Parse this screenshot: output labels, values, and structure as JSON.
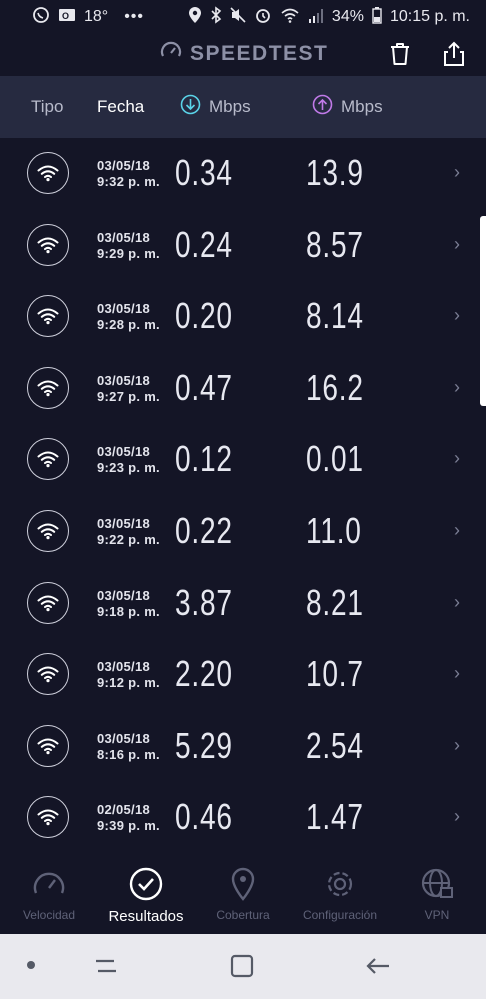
{
  "status_bar": {
    "temperature": "18°",
    "overflow": "•••",
    "battery": "34%",
    "time": "10:15 p. m."
  },
  "header": {
    "brand": "SPEEDTEST"
  },
  "columns": {
    "tipo": "Tipo",
    "fecha": "Fecha",
    "download": "Mbps",
    "upload": "Mbps"
  },
  "results": [
    {
      "date": "03/05/18",
      "time": "9:32 p. m.",
      "download": "0.34",
      "upload": "13.9"
    },
    {
      "date": "03/05/18",
      "time": "9:29 p. m.",
      "download": "0.24",
      "upload": "8.57"
    },
    {
      "date": "03/05/18",
      "time": "9:28 p. m.",
      "download": "0.20",
      "upload": "8.14"
    },
    {
      "date": "03/05/18",
      "time": "9:27 p. m.",
      "download": "0.47",
      "upload": "16.2"
    },
    {
      "date": "03/05/18",
      "time": "9:23 p. m.",
      "download": "0.12",
      "upload": "0.01"
    },
    {
      "date": "03/05/18",
      "time": "9:22 p. m.",
      "download": "0.22",
      "upload": "11.0"
    },
    {
      "date": "03/05/18",
      "time": "9:18 p. m.",
      "download": "3.87",
      "upload": "8.21"
    },
    {
      "date": "03/05/18",
      "time": "9:12 p. m.",
      "download": "2.20",
      "upload": "10.7"
    },
    {
      "date": "03/05/18",
      "time": "8:16 p. m.",
      "download": "5.29",
      "upload": "2.54"
    },
    {
      "date": "02/05/18",
      "time": "9:39 p. m.",
      "download": "0.46",
      "upload": "1.47"
    }
  ],
  "tabs": {
    "velocidad": "Velocidad",
    "resultados": "Resultados",
    "cobertura": "Cobertura",
    "configuracion": "Configuración",
    "vpn": "VPN"
  },
  "colors": {
    "background": "#141526",
    "header_band": "#262a40",
    "download_accent": "#5ad3e8",
    "upload_accent": "#c07ae8"
  }
}
